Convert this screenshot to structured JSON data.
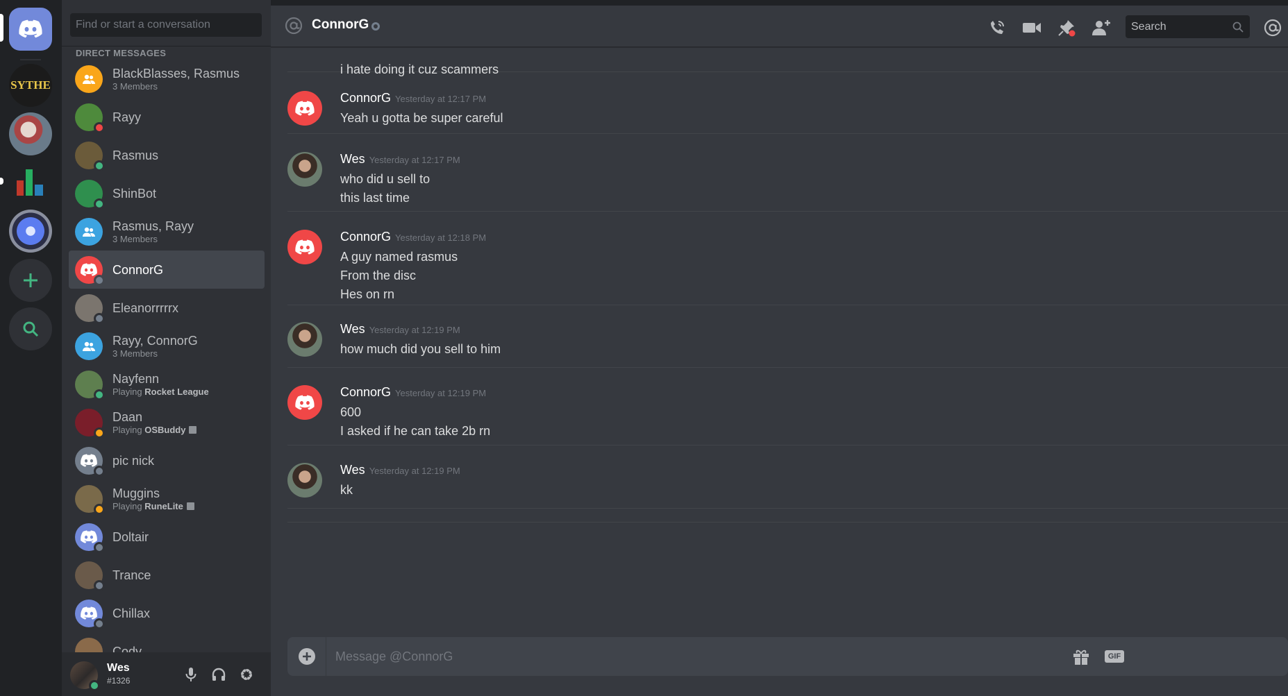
{
  "rail": {
    "servers": [
      {
        "name": "home-button",
        "label": ""
      },
      {
        "name": "server-sythe",
        "label": "SYTHE"
      },
      {
        "name": "server-2",
        "label": ""
      },
      {
        "name": "server-3",
        "label": ""
      },
      {
        "name": "server-4",
        "label": ""
      }
    ]
  },
  "sidebar": {
    "search_placeholder": "Find or start a conversation",
    "heading": "DIRECT MESSAGES",
    "dms": [
      {
        "name": "BlackBlasses, Rasmus",
        "sub": "3 Members",
        "group": true,
        "color": "#faa61a"
      },
      {
        "name": "Rayy",
        "status": "#f04747",
        "color": "#4e8a3c"
      },
      {
        "name": "Rasmus",
        "status": "#43b581",
        "color": "#6b5b3a"
      },
      {
        "name": "ShinBot",
        "status": "#43b581",
        "color": "#2f8f4e"
      },
      {
        "name": "Rasmus, Rayy",
        "sub": "3 Members",
        "group": true,
        "color": "#3ca3e0"
      },
      {
        "name": "ConnorG",
        "status": "#747f8d",
        "color": "#f04747",
        "active": true
      },
      {
        "name": "Eleanorrrrrx",
        "status": "#747f8d",
        "color": "#7b756e"
      },
      {
        "name": "Rayy, ConnorG",
        "sub": "3 Members",
        "group": true,
        "color": "#3ca3e0"
      },
      {
        "name": "Nayfenn",
        "sub_prefix": "Playing ",
        "sub_game": "Rocket League",
        "status": "#43b581",
        "color": "#5e7f4f"
      },
      {
        "name": "Daan",
        "sub_prefix": "Playing ",
        "sub_game": "OSBuddy",
        "status": "#faa61a",
        "color": "#7a1e2a",
        "game_icon": true
      },
      {
        "name": "pic nick",
        "status": "#747f8d",
        "color": "#747f8d"
      },
      {
        "name": "Muggins",
        "sub_prefix": "Playing ",
        "sub_game": "RuneLite",
        "status": "#faa61a",
        "color": "#7a6a4a",
        "game_icon": true
      },
      {
        "name": "Doltair",
        "status": "#747f8d",
        "color": "#7289da"
      },
      {
        "name": "Trance",
        "status": "#747f8d",
        "color": "#6a5a4a"
      },
      {
        "name": "Chillax",
        "status": "#747f8d",
        "color": "#7289da"
      },
      {
        "name": "Cody",
        "status": "#747f8d",
        "color": "#8a6a4a"
      }
    ]
  },
  "user": {
    "name": "Wes",
    "tag": "#1326"
  },
  "header": {
    "title": "ConnorG",
    "search_placeholder": "Search"
  },
  "messages": [
    {
      "author": "",
      "time": "",
      "lines": [
        "i hate doing it cuz scammers"
      ],
      "continued": true
    },
    {
      "author": "ConnorG",
      "time": "Yesterday at 12:17 PM",
      "lines": [
        "Yeah u gotta be super careful"
      ],
      "avatar": "discord"
    },
    {
      "author": "Wes",
      "time": "Yesterday at 12:17 PM",
      "lines": [
        "who did u sell to",
        "this last time"
      ],
      "avatar": "wes"
    },
    {
      "author": "ConnorG",
      "time": "Yesterday at 12:18 PM",
      "lines": [
        "A guy named rasmus",
        "From the disc",
        "Hes on rn"
      ],
      "avatar": "discord"
    },
    {
      "author": "Wes",
      "time": "Yesterday at 12:19 PM",
      "lines": [
        "how much did you sell to him"
      ],
      "avatar": "wes"
    },
    {
      "author": "ConnorG",
      "time": "Yesterday at 12:19 PM",
      "lines": [
        "600",
        "I asked if he can take 2b rn"
      ],
      "avatar": "discord"
    },
    {
      "author": "Wes",
      "time": "Yesterday at 12:19 PM",
      "lines": [
        "kk"
      ],
      "avatar": "wes"
    }
  ],
  "composer": {
    "placeholder": "Message @ConnorG",
    "gif_label": "GIF"
  }
}
